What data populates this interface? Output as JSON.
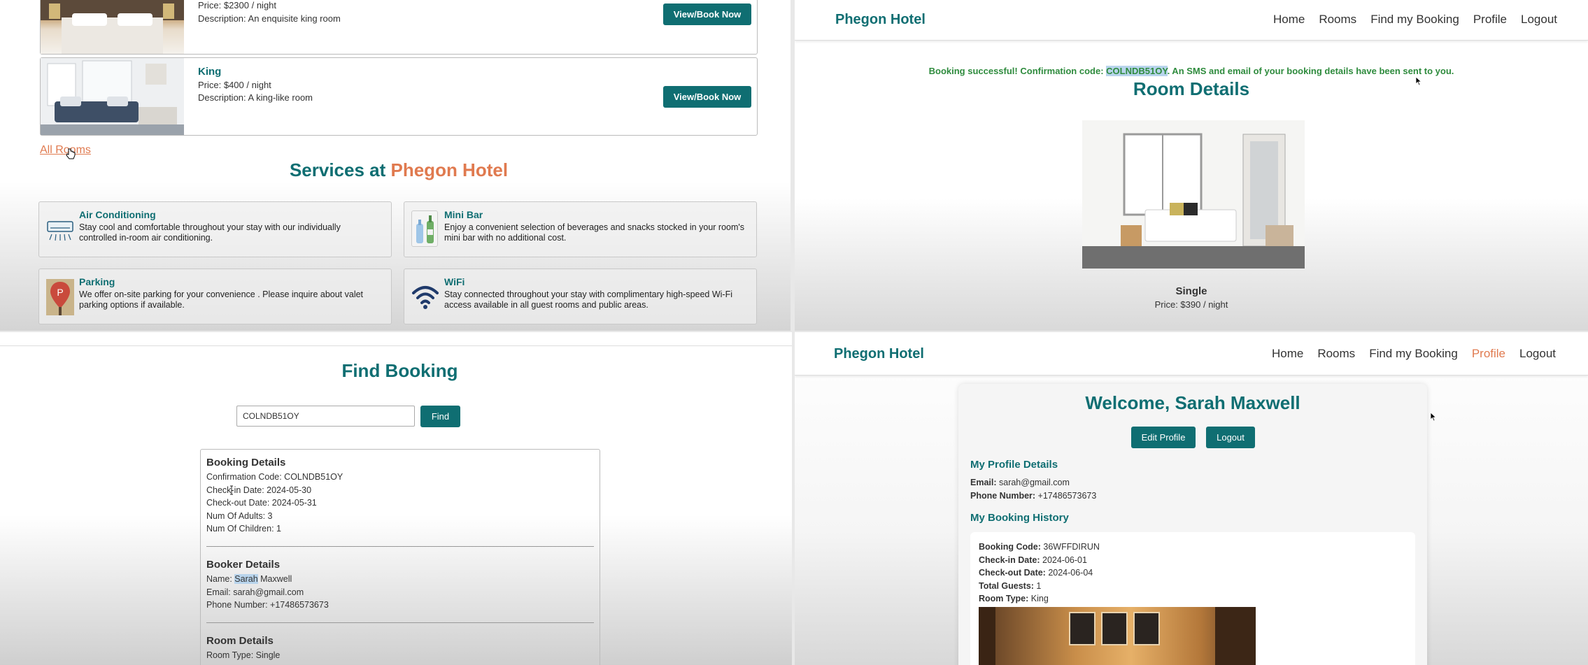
{
  "rooms_panel": {
    "rooms": [
      {
        "name": "",
        "price": "Price: $2300 / night",
        "description": "Description: An enquisite king room",
        "button": "View/Book Now"
      },
      {
        "name": "King",
        "price": "Price: $400 / night",
        "description": "Description: A king-like room",
        "button": "View/Book Now"
      }
    ],
    "all_rooms_link": "All Rooms",
    "services_heading_prefix": "Services at ",
    "services_heading_brand": "Phegon Hotel",
    "services": [
      {
        "title": "Air Conditioning",
        "desc": "Stay cool and comfortable throughout your stay with our individually controlled in-room air conditioning.",
        "icon": "air-conditioner-icon"
      },
      {
        "title": "Mini Bar",
        "desc": "Enjoy a convenient selection of beverages and snacks stocked in your room's mini bar with no additional cost.",
        "icon": "mini-bar-icon"
      },
      {
        "title": "Parking",
        "desc": "We offer on-site parking for your convenience . Please inquire about valet parking options if available.",
        "icon": "parking-icon"
      },
      {
        "title": "WiFi",
        "desc": "Stay connected throughout your stay with complimentary high-speed Wi-Fi access available in all guest rooms and public areas.",
        "icon": "wifi-icon"
      }
    ]
  },
  "nav": {
    "brand": "Phegon Hotel",
    "links": [
      "Home",
      "Rooms",
      "Find my Booking",
      "Profile",
      "Logout"
    ]
  },
  "room_details_panel": {
    "success_prefix": "Booking successful! Confirmation code: ",
    "success_code": "COLNDB51OY",
    "success_suffix": ". An SMS and email of your booking details have been sent to you.",
    "title": "Room Details",
    "room_type": "Single",
    "price": "Price: $390 / night"
  },
  "find_booking_panel": {
    "title": "Find Booking",
    "search_value": "COLNDB51OY",
    "find_button": "Find",
    "booking_details_heading": "Booking Details",
    "confirmation_code": "Confirmation Code: COLNDB51OY",
    "checkin": "Check-in Date: 2024-05-30",
    "checkout": "Check-out Date: 2024-05-31",
    "adults": "Num Of Adults: 3",
    "children": "Num Of Children: 1",
    "booker_heading": "Booker Details",
    "name_prefix": "Name: ",
    "first_name": "Sarah",
    "last_name": " Maxwell",
    "email": "Email: sarah@gmail.com",
    "phone": "Phone Number: +17486573673",
    "room_heading": "Room Details",
    "room_type": "Room Type: Single"
  },
  "profile_panel": {
    "welcome": "Welcome, Sarah Maxwell",
    "edit_button": "Edit Profile",
    "logout_button": "Logout",
    "details_heading": "My Profile Details",
    "email_label": "Email:",
    "email_value": " sarah@gmail.com",
    "phone_label": "Phone Number:",
    "phone_value": " +17486573673",
    "history_heading": "My Booking History",
    "booking": {
      "code_label": "Booking Code:",
      "code_value": " 36WFFDIRUN",
      "checkin_label": "Check-in Date:",
      "checkin_value": " 2024-06-01",
      "checkout_label": "Check-out Date:",
      "checkout_value": " 2024-06-04",
      "guests_label": "Total Guests:",
      "guests_value": " 1",
      "roomtype_label": "Room Type:",
      "roomtype_value": " King"
    }
  },
  "colors": {
    "teal": "#0f6e72",
    "orange": "#e07a4f",
    "success_green": "#2e8b3d"
  }
}
